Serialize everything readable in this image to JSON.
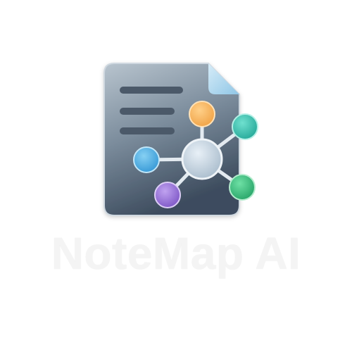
{
  "app": {
    "name": "NoteMap AI"
  },
  "logo": {
    "icon": "document-mind-map-icon",
    "colors": {
      "document_light": "#b7c3cd",
      "document_dark": "#3e4e60",
      "fold": "#a9d3ea",
      "lines": "#4c5a69",
      "hub": "#c8d8e6",
      "node_orange": "#f6b562",
      "node_teal": "#3ec3b2",
      "node_blue": "#4fb3e6",
      "node_purple": "#9a76d8",
      "node_green": "#3bc082",
      "connector": "#dfe7ee"
    }
  }
}
